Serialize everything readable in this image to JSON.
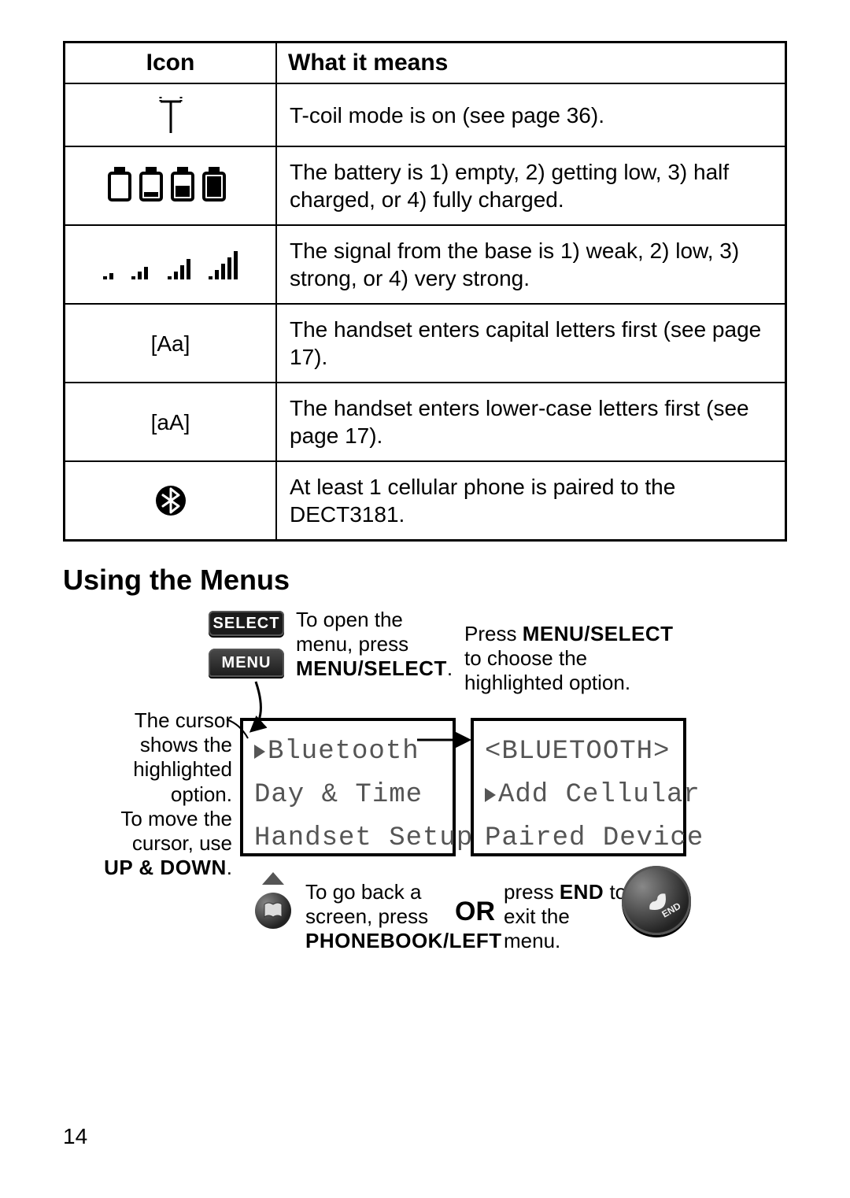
{
  "table": {
    "header_icon": "Icon",
    "header_meaning": "What it means",
    "rows": [
      {
        "icon": "tcoil",
        "icon_text": "",
        "meaning": "T-coil mode is on (see page 36)."
      },
      {
        "icon": "battery",
        "icon_text": "",
        "meaning": "The battery is 1) empty, 2) getting low, 3) half charged, or 4) fully charged."
      },
      {
        "icon": "signal",
        "icon_text": "",
        "meaning": "The signal from the base is 1) weak, 2) low, 3) strong, or 4) very strong."
      },
      {
        "icon": "text",
        "icon_text": "[Aa]",
        "meaning": "The handset enters capital letters first (see page 17)."
      },
      {
        "icon": "text",
        "icon_text": "[aA]",
        "meaning": "The handset enters lower-case letters first (see page 17)."
      },
      {
        "icon": "bluetooth",
        "icon_text": "",
        "meaning": "At least 1 cellular phone is paired to the DECT3181."
      }
    ]
  },
  "section_heading": "Using the Menus",
  "diagram": {
    "key_select_label": "SELECT",
    "key_menu_label": "MENU",
    "open_text_line1": "To open the",
    "open_text_line2": "menu, press",
    "open_text_bold": "MENU/SELECT",
    "open_text_period": ".",
    "press_text_line1_prefix": "Press ",
    "press_text_bold": "MENU/SELECT",
    "press_text_line2": "to choose the",
    "press_text_line3": "highlighted option.",
    "cursor_text_line1": "The cursor",
    "cursor_text_line2": "shows the",
    "cursor_text_line3": "highlighted",
    "cursor_text_line4": "option.",
    "cursor_text_line5": "To move the",
    "cursor_text_line6": "cursor, use",
    "cursor_text_bold": "UP & DOWN",
    "cursor_text_period2": ".",
    "back_text_line1": "To go back a",
    "back_text_line2": "screen, press",
    "back_text_bold": "PHONEBOOK/LEFT",
    "or_label": "OR",
    "end_text_prefix": "press ",
    "end_text_bold": "END",
    "end_text_suffix": " to",
    "end_text_line2": "exit the",
    "end_text_line3": "menu.",
    "lcd1_row1": "Bluetooth",
    "lcd1_row2": "Day & Time",
    "lcd1_row3": "Handset Setup",
    "lcd2_row1": "<BLUETOOTH>",
    "lcd2_row2": "Add Cellular",
    "lcd2_row3": "Paired Device"
  },
  "page_number": "14"
}
